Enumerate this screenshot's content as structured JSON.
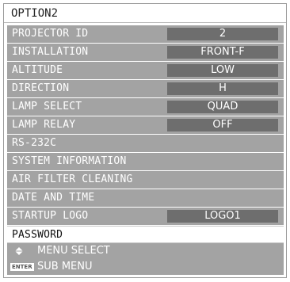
{
  "title": "OPTION2",
  "items": [
    {
      "label": "PROJECTOR ID",
      "value": "2"
    },
    {
      "label": "INSTALLATION",
      "value": "FRONT-F"
    },
    {
      "label": "ALTITUDE",
      "value": "LOW"
    },
    {
      "label": "DIRECTION",
      "value": "H"
    },
    {
      "label": "LAMP SELECT",
      "value": "QUAD"
    },
    {
      "label": "LAMP RELAY",
      "value": "OFF"
    },
    {
      "label": "RS-232C"
    },
    {
      "label": "SYSTEM INFORMATION"
    },
    {
      "label": "AIR FILTER CLEANING"
    },
    {
      "label": "DATE AND TIME"
    },
    {
      "label": "STARTUP LOGO",
      "value": "LOGO1"
    },
    {
      "label": "PASSWORD",
      "selected": true
    }
  ],
  "footer": {
    "menu_select": "MENU SELECT",
    "enter_badge": "ENTER",
    "sub_menu": "SUB MENU",
    "select_icon": "up-down-diamond-icon"
  },
  "colors": {
    "row_background": "#a3a3a3",
    "value_box": "#6e6e6e",
    "selected_row": "#ffffff",
    "text": "#ffffff"
  }
}
